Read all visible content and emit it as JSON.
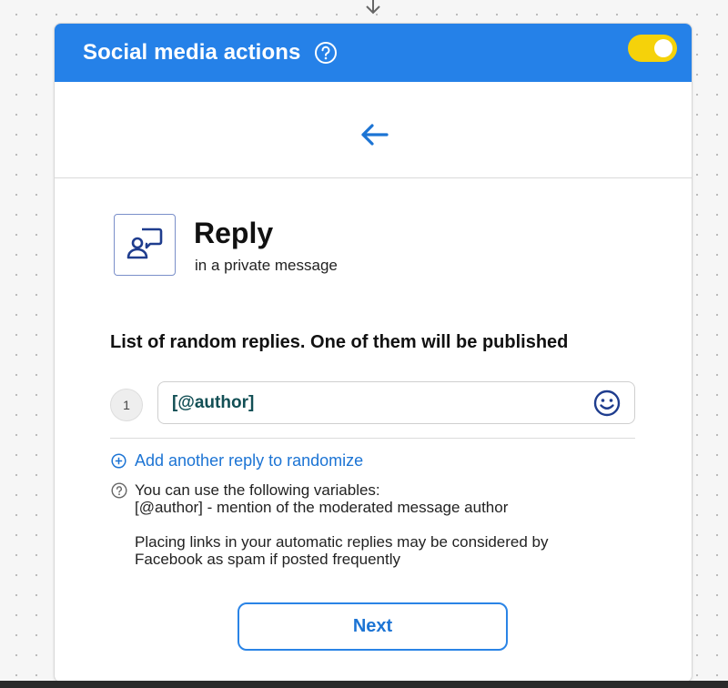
{
  "header": {
    "title": "Social media actions",
    "help_icon": "question-circle-icon",
    "toggle_on": true,
    "accent_color": "#2581e8",
    "toggle_color": "#f5d20a"
  },
  "navigation": {
    "back_icon": "arrow-left-icon"
  },
  "action": {
    "icon": "reply-chat-person-icon",
    "title": "Reply",
    "subtitle": "in a private message"
  },
  "replies": {
    "heading": "List of random replies. One of them will be published",
    "items": [
      {
        "number": "1",
        "value": "[@author]"
      }
    ],
    "add_label": "Add another reply to randomize"
  },
  "hint": {
    "line1": "You can use the following variables:",
    "line2": "[@author] - mention of the moderated message author",
    "line3": "Placing links in your automatic replies may be considered by",
    "line4": "Facebook as spam if posted frequently"
  },
  "footer": {
    "next_label": "Next"
  }
}
